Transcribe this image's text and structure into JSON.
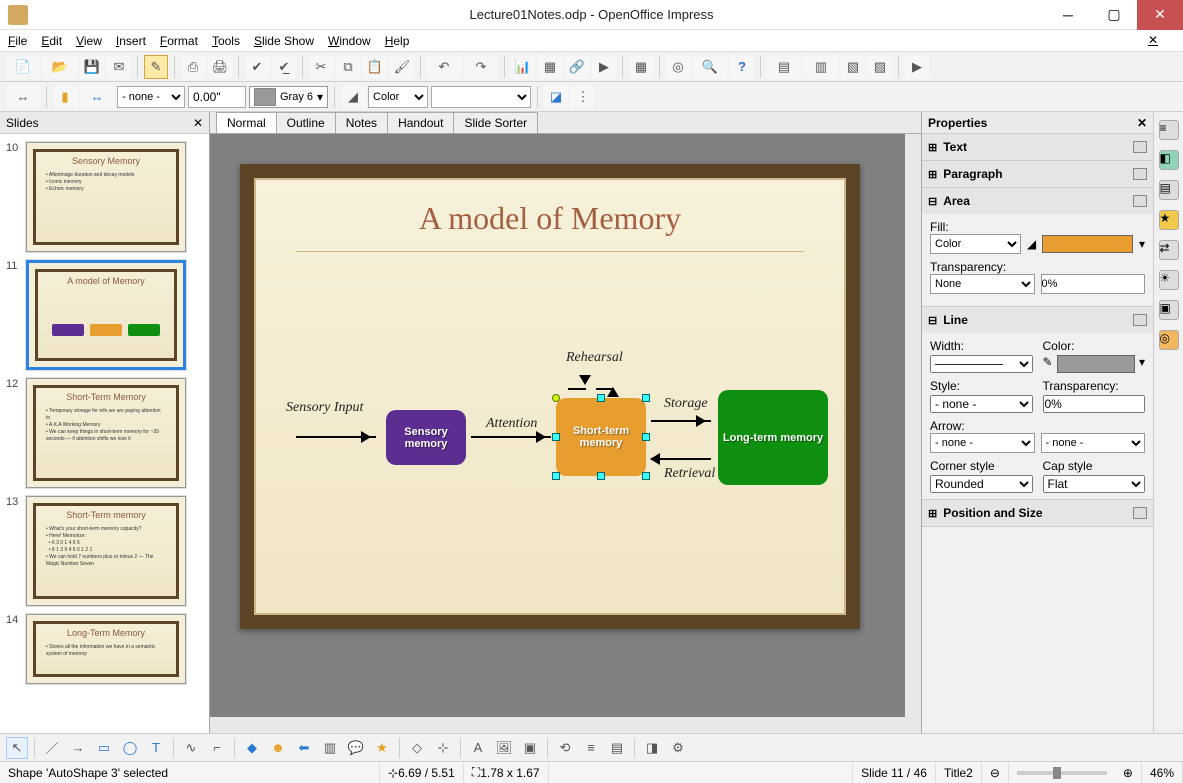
{
  "window": {
    "title": "Lecture01Notes.odp - OpenOffice Impress"
  },
  "menu": [
    "File",
    "Edit",
    "View",
    "Insert",
    "Format",
    "Tools",
    "Slide Show",
    "Window",
    "Help"
  ],
  "toolbar2": {
    "line_style": "- none -",
    "line_width": "0.00\"",
    "color_name": "Gray 6",
    "fill_mode": "Color"
  },
  "slides_panel": {
    "title": "Slides"
  },
  "thumbs": [
    {
      "num": "10",
      "title": "Sensory Memory"
    },
    {
      "num": "11",
      "title": "A model of Memory",
      "selected": true
    },
    {
      "num": "12",
      "title": "Short-Term Memory"
    },
    {
      "num": "13",
      "title": "Short-Term memory"
    },
    {
      "num": "14",
      "title": "Long-Term Memory"
    }
  ],
  "view_tabs": [
    "Normal",
    "Outline",
    "Notes",
    "Handout",
    "Slide Sorter"
  ],
  "slide": {
    "title": "A model of Memory",
    "labels": {
      "sensory_input": "Sensory Input",
      "attention": "Attention",
      "rehearsal": "Rehearsal",
      "storage": "Storage",
      "retrieval": "Retrieval"
    },
    "boxes": {
      "sensory": "Sensory memory",
      "short": "Short-term memory",
      "long": "Long-term memory"
    }
  },
  "properties": {
    "title": "Properties",
    "sections": {
      "text": "Text",
      "paragraph": "Paragraph",
      "area": "Area",
      "line": "Line",
      "pos": "Position and Size"
    },
    "area": {
      "fill_label": "Fill:",
      "fill_type": "Color",
      "transparency_label": "Transparency:",
      "transparency_type": "None",
      "transparency_val": "0%"
    },
    "line": {
      "width_label": "Width:",
      "color_label": "Color:",
      "style_label": "Style:",
      "style_val": "- none -",
      "transparency_label": "Transparency:",
      "transparency_val": "0%",
      "arrow_label": "Arrow:",
      "arrow_start": "- none -",
      "arrow_end": "- none -",
      "corner_label": "Corner style",
      "corner_val": "Rounded",
      "cap_label": "Cap style",
      "cap_val": "Flat"
    }
  },
  "status": {
    "selection": "Shape 'AutoShape 3' selected",
    "pos": "6.69 / 5.51",
    "size": "1.78 x 1.67",
    "slide": "Slide 11 / 46",
    "master": "Title2",
    "zoom": "46%"
  }
}
